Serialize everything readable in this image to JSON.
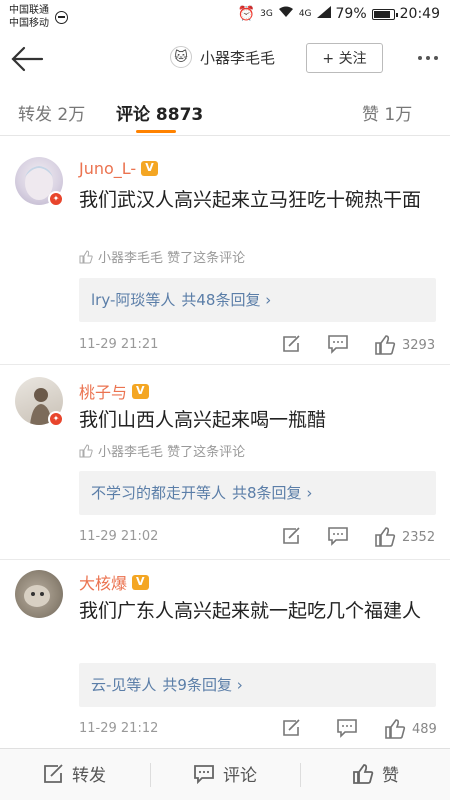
{
  "statusbar": {
    "carrier1": "中国联通",
    "carrier2": "中国移动",
    "net1": "3G",
    "net2": "4G",
    "battery": "79%",
    "battery_level": 0.79,
    "time": "20:49"
  },
  "header": {
    "title": "小器李毛毛",
    "follow_label": "+ 关注"
  },
  "tabs": {
    "repost": "转发 2万",
    "comments": "评论 8873",
    "likes": "赞 1万"
  },
  "comments": [
    {
      "username": "Juno_L-",
      "text": "我们武汉人高兴起来立马狂吃十碗热干面",
      "liked_by": "小器李毛毛 赞了这条评论",
      "replies_users": "lry-阿琰等人",
      "replies_count": "共48条回复 ›",
      "time": "11-29 21:21",
      "likes": "3293"
    },
    {
      "username": "桃子与",
      "text": "我们山西人高兴起来喝一瓶醋",
      "liked_by": "小器李毛毛 赞了这条评论",
      "replies_users": "不学习的都走开等人",
      "replies_count": "共8条回复 ›",
      "time": "11-29 21:02",
      "likes": "2352"
    },
    {
      "username": "大核爆",
      "text": "我们广东人高兴起来就一起吃几个福建人",
      "replies_users": "云-见等人",
      "replies_count": "共9条回复 ›",
      "time": "11-29 21:12",
      "likes": "489"
    }
  ],
  "bottombar": {
    "repost": "转发",
    "comment": "评论",
    "like": "赞"
  }
}
